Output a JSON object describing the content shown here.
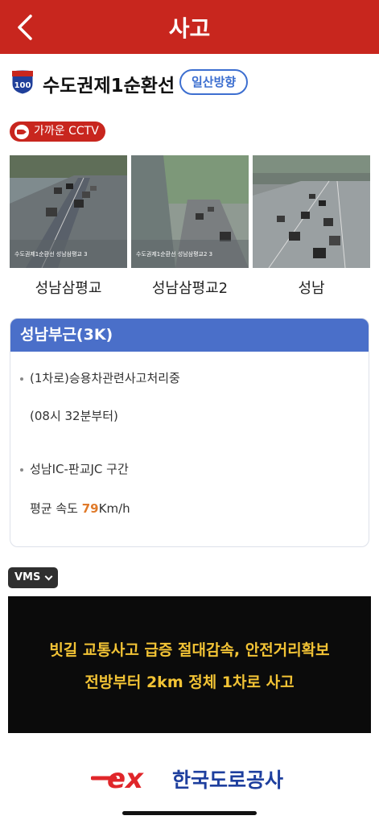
{
  "header": {
    "title": "사고",
    "back_icon": "chevron-left-icon"
  },
  "road": {
    "route_number": "100",
    "name": "수도권제1순환선",
    "direction": "일산방향"
  },
  "cctv": {
    "chip_label": "가까운 CCTV",
    "cameras": [
      {
        "label": "성남삼평교",
        "overlay_caption": "수도권제1순환선 성남삼평교 3"
      },
      {
        "label": "성남삼평교2",
        "overlay_caption": "수도권제1순환선 성남삼평교2 3"
      },
      {
        "label": "성남",
        "overlay_caption": ""
      }
    ]
  },
  "incident": {
    "title": "성남부근(3K)",
    "detail": "(1차로)승용차관련사고처리중",
    "since": "(08시 32분부터)",
    "section": "성남IC-판교JC 구간",
    "avg_speed_label": "평균 속도",
    "avg_speed_value": "79",
    "avg_speed_unit": "Km/h"
  },
  "vms": {
    "chip_label": "VMS",
    "line1": "빗길 교통사고 급증 절대감속, 안전거리확보",
    "line2": "전방부터 2km 정체 1차로 사고"
  },
  "footer": {
    "logo_mark": "ex",
    "logo_text": "한국도로공사"
  },
  "colors": {
    "header_red": "#c8261e",
    "card_blue": "#4a6fc9",
    "vms_text": "#f2c335",
    "speed": "#e07a2a"
  }
}
